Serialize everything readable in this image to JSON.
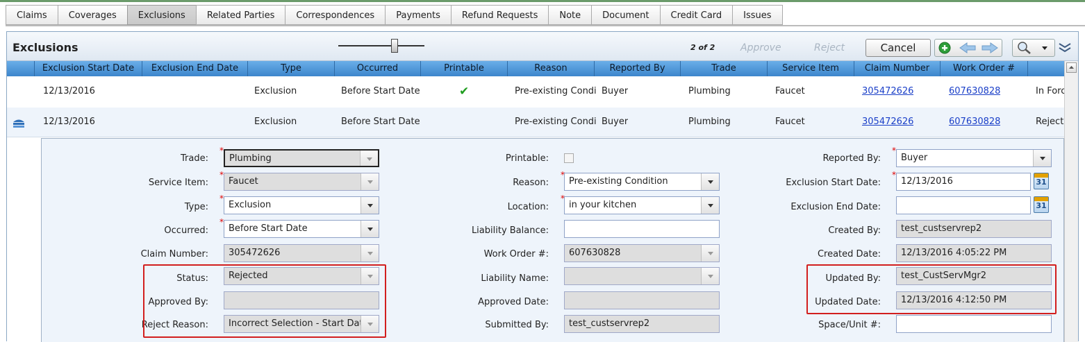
{
  "tabs": [
    "Claims",
    "Coverages",
    "Exclusions",
    "Related Parties",
    "Correspondences",
    "Payments",
    "Refund Requests",
    "Note",
    "Document",
    "Credit Card",
    "Issues"
  ],
  "toolbar": {
    "title": "Exclusions",
    "pager": "2 of 2",
    "approve": "Approve",
    "reject": "Reject",
    "cancel": "Cancel"
  },
  "columns": [
    "Exclusion Start Date",
    "Exclusion End Date",
    "Type",
    "Occurred",
    "Printable",
    "Reason",
    "Reported By",
    "Trade",
    "Service Item",
    "Claim Number",
    "Work Order #"
  ],
  "rows": [
    {
      "start": "12/13/2016",
      "end": "",
      "type": "Exclusion",
      "occurred": "Before Start Date",
      "printable": "✔",
      "reason": "Pre-existing Condi",
      "reported_by": "Buyer",
      "trade": "Plumbing",
      "service_item": "Faucet",
      "claim_number": "305472626",
      "work_order": "607630828",
      "status": "In Forc"
    },
    {
      "start": "12/13/2016",
      "end": "",
      "type": "Exclusion",
      "occurred": "Before Start Date",
      "printable": "",
      "reason": "Pre-existing Condi",
      "reported_by": "Buyer",
      "trade": "Plumbing",
      "service_item": "Faucet",
      "claim_number": "305472626",
      "work_order": "607630828",
      "status": "Rejecte"
    }
  ],
  "form": {
    "trade": {
      "label": "Trade:",
      "value": "Plumbing"
    },
    "service_item": {
      "label": "Service Item:",
      "value": "Faucet"
    },
    "type": {
      "label": "Type:",
      "value": "Exclusion"
    },
    "occurred": {
      "label": "Occurred:",
      "value": "Before Start Date"
    },
    "claim_number": {
      "label": "Claim Number:",
      "value": "305472626"
    },
    "status": {
      "label": "Status:",
      "value": "Rejected"
    },
    "approved_by": {
      "label": "Approved By:",
      "value": ""
    },
    "reject_reason": {
      "label": "Reject Reason:",
      "value": "Incorrect Selection - Start Date"
    },
    "printable": {
      "label": "Printable:"
    },
    "reason": {
      "label": "Reason:",
      "value": "Pre-existing Condition"
    },
    "location": {
      "label": "Location:",
      "value": "in your kitchen"
    },
    "liability_balance": {
      "label": "Liability Balance:",
      "value": ""
    },
    "work_order": {
      "label": "Work Order #:",
      "value": "607630828"
    },
    "liability_name": {
      "label": "Liability Name:",
      "value": ""
    },
    "approved_date": {
      "label": "Approved Date:",
      "value": ""
    },
    "submitted_by": {
      "label": "Submitted By:",
      "value": "test_custservrep2"
    },
    "reported_by": {
      "label": "Reported By:",
      "value": "Buyer"
    },
    "exclusion_start": {
      "label": "Exclusion Start Date:",
      "value": "12/13/2016"
    },
    "exclusion_end": {
      "label": "Exclusion End Date:",
      "value": ""
    },
    "created_by": {
      "label": "Created By:",
      "value": "test_custservrep2"
    },
    "created_date": {
      "label": "Created Date:",
      "value": "12/13/2016 4:05:22 PM"
    },
    "updated_by": {
      "label": "Updated By:",
      "value": "test_CustServMgr2"
    },
    "updated_date": {
      "label": "Updated Date:",
      "value": "12/13/2016 4:12:50 PM"
    },
    "space_unit": {
      "label": "Space/Unit #:",
      "value": ""
    },
    "calendar_day": "31"
  },
  "colors": {
    "header_blue": "#4a94d8",
    "highlight_red": "#d21e1e",
    "check_green": "#1f9d1f",
    "link_blue": "#1a3fc8"
  },
  "icons": [
    "add-icon",
    "back-arrow-icon",
    "forward-arrow-icon",
    "search-icon",
    "dropdown-icon",
    "collapse-chevron-icon",
    "calendar-icon",
    "record-stack-icon"
  ]
}
